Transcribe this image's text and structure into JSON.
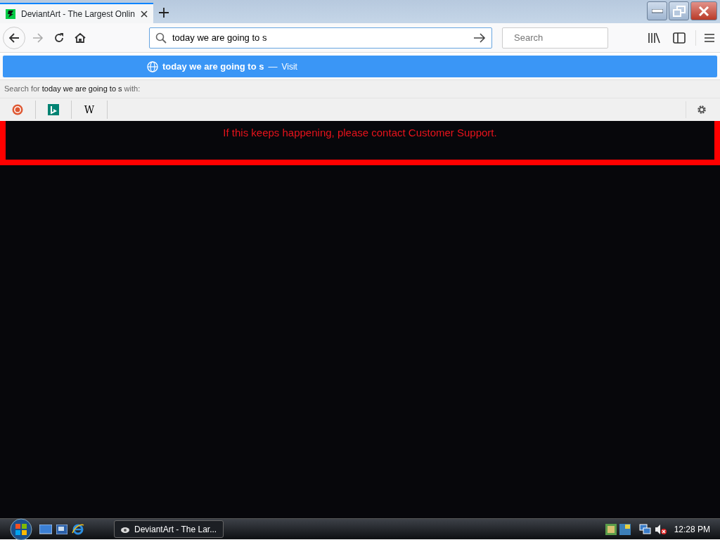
{
  "tab": {
    "title": "DeviantArt - The Largest Onlin",
    "selected": true
  },
  "address_bar": {
    "value": "today we are going to s"
  },
  "search_field": {
    "placeholder": "Search"
  },
  "suggestion": {
    "text": "today we are going to s",
    "separator": "—",
    "action": "Visit"
  },
  "search_with": {
    "prefix": "Search for",
    "query": "today we are going to s",
    "suffix": "with:"
  },
  "engines": [
    {
      "kind": "duckduckgo"
    },
    {
      "kind": "bing"
    },
    {
      "kind": "wikipedia",
      "label": "W"
    }
  ],
  "page": {
    "error_message": "If this keeps happening, please contact Customer Support."
  },
  "taskbar": {
    "window_button": "DeviantArt - The Lar...",
    "clock": "12:28 PM"
  }
}
